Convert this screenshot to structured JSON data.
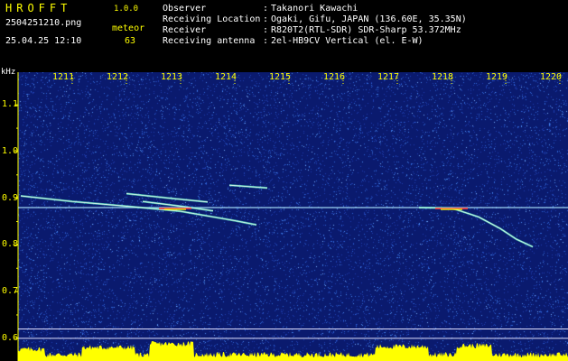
{
  "header": {
    "app_title": "HROFFT",
    "app_version": "1.0.0",
    "file_name": "2504251210.png",
    "timestamp": "25.04.25 12:10",
    "detection_label": "meteor",
    "detection_count": "63"
  },
  "info": {
    "observer_key": "Observer",
    "observer_value": "Takanori Kawachi",
    "location_key": "Receiving Location",
    "location_value": "Ogaki, Gifu, JAPAN (136.60E, 35.35N)",
    "receiver_key": "Receiver",
    "receiver_value": "R820T2(RTL-SDR) SDR-Sharp 53.372MHz",
    "antenna_key": "Receiving antenna",
    "antenna_value": "2el-HB9CV Vertical (el. E-W)",
    "separator": ":"
  },
  "chart_data": {
    "type": "heatmap",
    "y_unit": "kHz",
    "x_ticks": [
      "1211",
      "1212",
      "1213",
      "1214",
      "1215",
      "1216",
      "1217",
      "1218",
      "1219",
      "1220"
    ],
    "y_ticks": [
      "1.1",
      "1.0",
      "0.9",
      "0.8",
      "0.7",
      "0.6"
    ],
    "x_range": [
      1210,
      1220
    ],
    "y_range": [
      0.59,
      1.17
    ],
    "carrier_khz": 0.88,
    "reference_lines_khz": [
      0.62,
      0.6
    ],
    "traces": [
      {
        "x": [
          1210.05,
          1211.0,
          1212.0,
          1213.0,
          1214.0,
          1214.4
        ],
        "y": [
          0.905,
          0.893,
          0.883,
          0.872,
          0.852,
          0.843
        ]
      },
      {
        "x": [
          1212.3,
          1213.0,
          1213.6
        ],
        "y": [
          0.893,
          0.883,
          0.873
        ]
      },
      {
        "x": [
          1212.0,
          1212.8,
          1213.5
        ],
        "y": [
          0.91,
          0.9,
          0.892
        ]
      },
      {
        "x": [
          1213.9,
          1214.6
        ],
        "y": [
          0.928,
          0.922
        ]
      },
      {
        "x": [
          1217.4,
          1218.0,
          1218.5,
          1218.9,
          1219.2,
          1219.5
        ],
        "y": [
          0.88,
          0.879,
          0.86,
          0.835,
          0.812,
          0.796
        ]
      }
    ],
    "background_color": "#0a1a6e",
    "signal_colors": [
      "#ffffff",
      "#ff3030",
      "#ffff00",
      "#00ff40",
      "#00c0ff"
    ],
    "histogram_color": "#ffff00"
  }
}
